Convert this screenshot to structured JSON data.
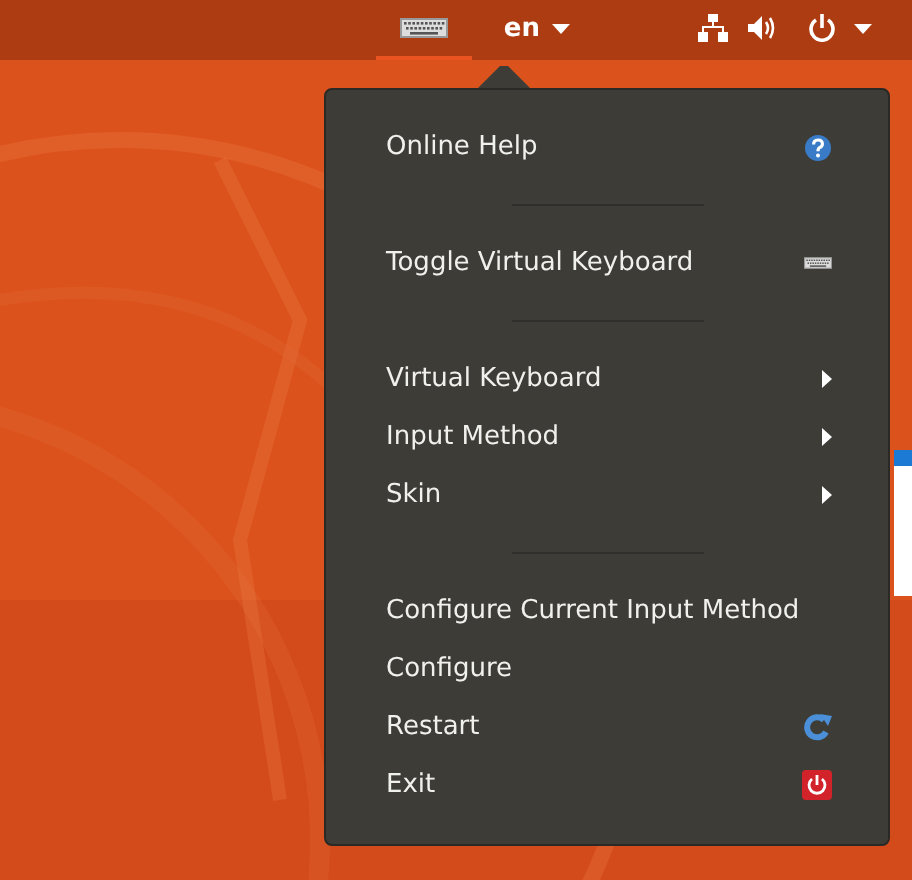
{
  "top_bar": {
    "indicators": [
      {
        "kind": "keyboard",
        "selected": true
      },
      {
        "kind": "language",
        "label": "en",
        "selected": false
      },
      {
        "kind": "network",
        "selected": false
      },
      {
        "kind": "volume",
        "selected": false
      },
      {
        "kind": "power",
        "selected": false
      }
    ]
  },
  "menu": {
    "items": [
      {
        "kind": "help",
        "label": "Online Help"
      },
      {
        "kind": "separator"
      },
      {
        "kind": "keyboard",
        "label": "Toggle Virtual Keyboard"
      },
      {
        "kind": "separator"
      },
      {
        "kind": "submenu",
        "label": "Virtual Keyboard"
      },
      {
        "kind": "submenu",
        "label": "Input Method"
      },
      {
        "kind": "submenu",
        "label": "Skin"
      },
      {
        "kind": "separator"
      },
      {
        "kind": "plain",
        "label": "Configure Current Input Method"
      },
      {
        "kind": "plain",
        "label": "Configure"
      },
      {
        "kind": "restart",
        "label": "Restart"
      },
      {
        "kind": "exit",
        "label": "Exit"
      }
    ]
  }
}
